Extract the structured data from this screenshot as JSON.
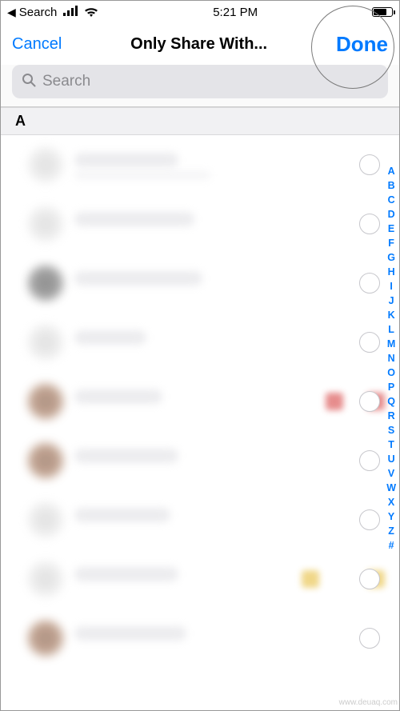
{
  "status_bar": {
    "back_label": "Search",
    "time": "5:21 PM"
  },
  "nav": {
    "cancel": "Cancel",
    "title": "Only Share With...",
    "done": "Done"
  },
  "search": {
    "placeholder": "Search"
  },
  "section": {
    "letter": "A"
  },
  "index_letters": [
    "A",
    "B",
    "C",
    "D",
    "E",
    "F",
    "G",
    "H",
    "I",
    "J",
    "K",
    "L",
    "M",
    "N",
    "O",
    "P",
    "Q",
    "R",
    "S",
    "T",
    "U",
    "V",
    "W",
    "X",
    "Y",
    "Z",
    "#"
  ],
  "watermark": "www.deuaq.com"
}
